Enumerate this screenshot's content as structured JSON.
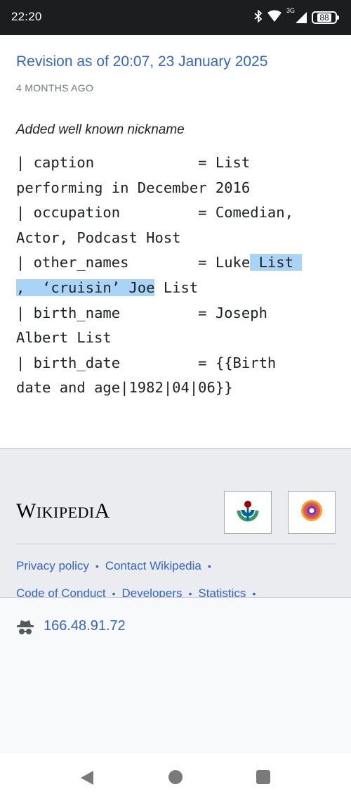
{
  "status_bar": {
    "time": "22:20",
    "network_label": "3G",
    "battery": "88",
    "icons": [
      "bluetooth-icon",
      "wifi-icon",
      "signal-icon",
      "battery-icon"
    ]
  },
  "revision": {
    "title": "Revision as of 20:07, 23 January 2025",
    "age": "4 MONTHS AGO",
    "summary": "Added well known nickname",
    "code_lines": {
      "l1": "| caption            = List",
      "l2": "performing in December 2016",
      "l3": "| occupation         = Comedian,",
      "l4": "Actor, Podcast Host",
      "l5_pre": "| other_names        = Luke",
      "l5_hl": " List ",
      "l6_hl": ",  ‘cruisin’ Joe",
      "l6_post": " List",
      "l7": "| birth_name         = Joseph",
      "l8": "Albert List",
      "l9": "| birth_date         = {{Birth",
      "l10": "date and age|1982|04|06}}"
    },
    "highlight_color": "#aad4f7"
  },
  "footer": {
    "wordmark_parts": [
      "W",
      "IKIPEDI",
      "A"
    ],
    "badges": [
      "wikimedia-foundation-icon",
      "mediawiki-icon"
    ],
    "links": {
      "privacy": "Privacy policy",
      "contact": "Contact Wikipedia",
      "conduct": "Code of Conduct",
      "developers": "Developers",
      "statistics": "Statistics",
      "separator": "•"
    }
  },
  "ip_bar": {
    "icon": "anonymous-user-icon",
    "ip": "166.48.91.72"
  },
  "nav_bar": {
    "icons": [
      "back-icon",
      "home-icon",
      "recents-icon"
    ]
  },
  "colors": {
    "link": "#3366cc",
    "footer_bg": "#eaecf0",
    "ip_bar_bg": "#f8f9fa",
    "status_bar_bg": "#1b1d1f"
  }
}
